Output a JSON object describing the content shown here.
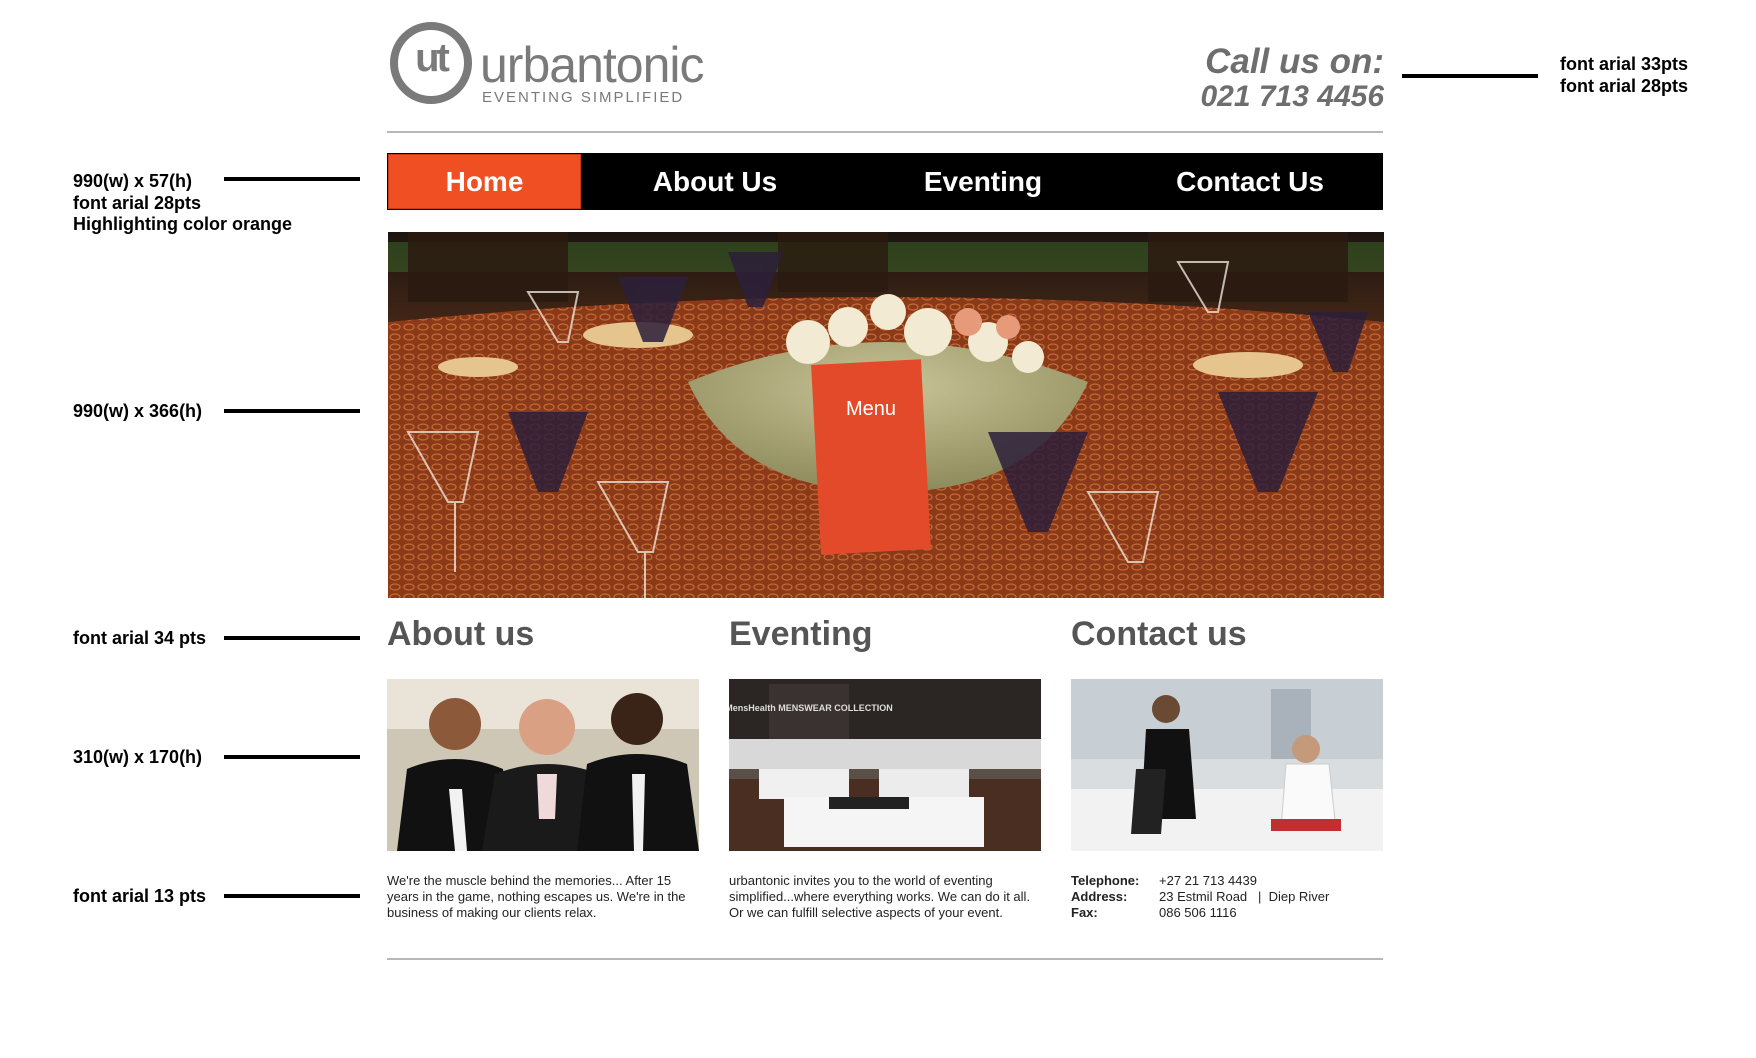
{
  "logo": {
    "monogram": "ut",
    "wordmark": "urbantonic",
    "tagline": "EVENTING SIMPLIFIED"
  },
  "call": {
    "label": "Call us on:",
    "number": "021 713 4456"
  },
  "nav": {
    "items": [
      {
        "label": "Home",
        "active": true
      },
      {
        "label": "About Us",
        "active": false
      },
      {
        "label": "Eventing",
        "active": false
      },
      {
        "label": "Contact Us",
        "active": false
      }
    ]
  },
  "hero": {
    "menu_card_text": "Menu"
  },
  "thumbs": {
    "eventing_banner": "MensHealth MENSWEAR COLLECTION"
  },
  "sections": {
    "about": {
      "title": "About us",
      "text": "We're the muscle behind the memories... After 15 years in the game, nothing escapes us. We're in the business of making our clients relax."
    },
    "eventing": {
      "title": "Eventing",
      "text": "urbantonic invites you to the world of eventing simplified...where everything works. We can do it all. Or we can fulfill selective aspects of your event."
    },
    "contact": {
      "title": "Contact us",
      "rows": [
        {
          "label": "Telephone:",
          "value": "+27 21 713 4439"
        },
        {
          "label": "Address:",
          "value": "23 Estmil Road   |  Diep River"
        },
        {
          "label": "Fax:",
          "value": "086 506 1116"
        }
      ]
    }
  },
  "annotations": {
    "left": [
      "990(w) x 57(h)",
      "font arial 28pts",
      "Highlighting color orange",
      "990(w) x 366(h)",
      "font arial 34 pts",
      "310(w) x 170(h)",
      "font arial 13 pts"
    ],
    "right": [
      "font arial 33pts",
      "font arial 28pts"
    ]
  },
  "colors": {
    "nav_background": "#000000",
    "nav_active": "#f04e23",
    "logo_grey": "#7a7a7a",
    "heading_grey": "#555555"
  }
}
